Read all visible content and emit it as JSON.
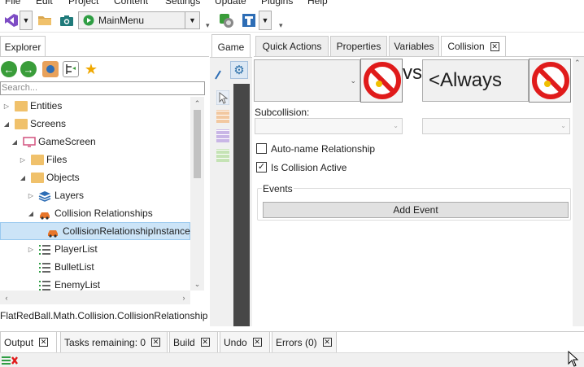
{
  "menu": [
    "File",
    "Edit",
    "Project",
    "Content",
    "Settings",
    "Update",
    "Plugins",
    "Help"
  ],
  "toolbar": {
    "screen_combo": "MainMenu"
  },
  "explorer": {
    "tab_label": "Explorer",
    "search_placeholder": "Search...",
    "tree": [
      {
        "label": "Entities",
        "level": 0,
        "expander": "collapsed",
        "icon": "folder-icon"
      },
      {
        "label": "Screens",
        "level": 0,
        "expander": "expanded",
        "icon": "folder-icon"
      },
      {
        "label": "GameScreen",
        "level": 1,
        "expander": "expanded",
        "icon": "screen-icon"
      },
      {
        "label": "Files",
        "level": 2,
        "expander": "collapsed",
        "icon": "folder-icon"
      },
      {
        "label": "Objects",
        "level": 2,
        "expander": "expanded",
        "icon": "folder-icon"
      },
      {
        "label": "Layers",
        "level": 3,
        "expander": "collapsed",
        "icon": "layers-icon"
      },
      {
        "label": "Collision Relationships",
        "level": 3,
        "expander": "expanded",
        "icon": "collision-icon"
      },
      {
        "label": "CollisionRelationshipInstance",
        "level": 4,
        "expander": "none",
        "icon": "collision-icon",
        "selected": true
      },
      {
        "label": "PlayerList",
        "level": 3,
        "expander": "collapsed",
        "icon": "list-icon"
      },
      {
        "label": "BulletList",
        "level": 3,
        "expander": "none",
        "icon": "list-icon"
      },
      {
        "label": "EnemyList",
        "level": 3,
        "expander": "none",
        "icon": "list-icon"
      }
    ],
    "selected_path": "FlatRedBall.Math.Collision.CollisionRelationship"
  },
  "game": {
    "tab_label": "Game"
  },
  "collision": {
    "tabs": [
      "Quick Actions",
      "Properties",
      "Variables",
      "Collision"
    ],
    "active_tab": "Collision",
    "first_object": "",
    "vs_label": "vs",
    "second_object": "<Always",
    "subcollision_label": "Subcollision:",
    "auto_name_label": "Auto-name Relationship",
    "auto_name_checked": false,
    "is_active_label": "Is Collision Active",
    "is_active_checked": true,
    "events_label": "Events",
    "add_event_label": "Add Event"
  },
  "bottom_tabs": [
    {
      "label": "Output",
      "active": true
    },
    {
      "label": "Tasks remaining: 0",
      "active": false
    },
    {
      "label": "Build",
      "active": false
    },
    {
      "label": "Undo",
      "active": false
    },
    {
      "label": "Errors (0)",
      "active": false
    }
  ],
  "colors": {
    "selection": "#cce4f7",
    "folder": "#f0c16b",
    "dark_panel": "#474747",
    "no_sign_red": "#e01b1b"
  }
}
